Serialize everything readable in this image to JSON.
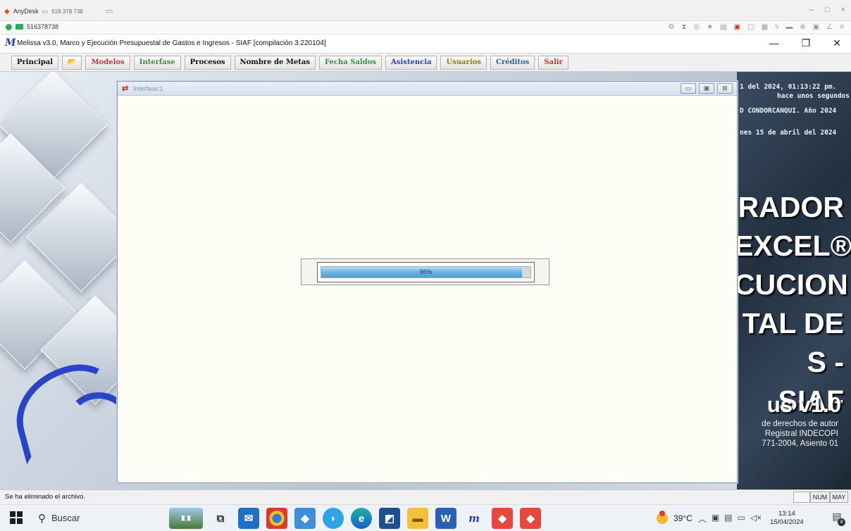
{
  "anydesk": {
    "app_name": "AnyDesk",
    "tab_address": "516 378 738",
    "session_id": "516378738"
  },
  "app": {
    "title": "Melissa v3.0, Marco y Ejecución Presupuestal de Gastos e Ingresos - SIAF  [compilación 3.220104]"
  },
  "menu": [
    {
      "label": "Principal",
      "color": "#111111"
    },
    {
      "label": "📂",
      "color": "#7a5a00"
    },
    {
      "label": "Modelos",
      "color": "#b03a3a"
    },
    {
      "label": "Interfase",
      "color": "#3e8a3e"
    },
    {
      "label": "Procesos",
      "color": "#111111"
    },
    {
      "label": "Nombre de Metas",
      "color": "#111111"
    },
    {
      "label": "Fecha Saldos",
      "color": "#3e8a3e"
    },
    {
      "label": "Asistencia",
      "color": "#2a3fa8"
    },
    {
      "label": "Usuarios",
      "color": "#8a7a10"
    },
    {
      "label": "Créditos",
      "color": "#2d5f8f"
    },
    {
      "label": "Salir",
      "color": "#c0392b"
    }
  ],
  "inner_window": {
    "title": "Interfase:1",
    "progress_percent": 96,
    "progress_label": "96%"
  },
  "background_panel": {
    "date_line": "1 del 2024, 01:13:22 pm.",
    "ago_line": "hace unos segundos",
    "entity_line": "D CONDORCANQUI. Año 2024",
    "today_line": "nes 15 de abril del 2024",
    "big_lines": [
      "RADOR",
      "EXCEL®",
      "CUCION",
      "TAL DE",
      "S - SIAF"
    ],
    "version": "us v1.0",
    "copyright_lines": [
      "de derechos de autor",
      "Registral INDECOPI",
      "771-2004, Asiento 01"
    ]
  },
  "status": {
    "message": "Se ha eliminado el archivo.",
    "num": "NUM",
    "may": "MAY"
  },
  "taskbar": {
    "search_placeholder": "Buscar",
    "temperature": "39°C",
    "time": "13:14",
    "date": "15/04/2024",
    "notifications": "4"
  }
}
